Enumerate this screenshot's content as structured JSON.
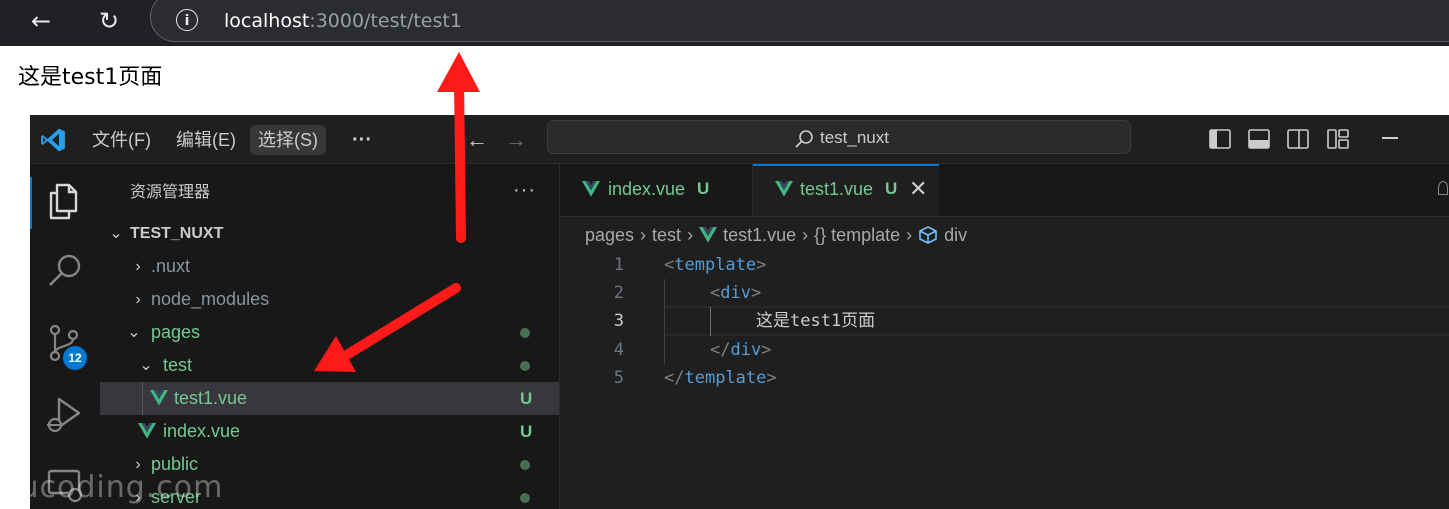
{
  "browser": {
    "url_host": "localhost",
    "url_path": ":3000/test/test1"
  },
  "page": {
    "heading": "这是test1页面"
  },
  "vscode": {
    "menu": {
      "file": "文件(F)",
      "edit": "编辑(E)",
      "select": "选择(S)",
      "more": "···"
    },
    "command_center": "test_nuxt",
    "badge_count": "12",
    "explorer": {
      "title": "资源管理器",
      "more": "···",
      "root": "TEST_NUXT",
      "items": [
        {
          "label": ".nuxt"
        },
        {
          "label": "node_modules"
        },
        {
          "label": "pages"
        },
        {
          "label": "test"
        },
        {
          "label": "test1.vue",
          "status": "U"
        },
        {
          "label": "index.vue",
          "status": "U"
        },
        {
          "label": "public"
        },
        {
          "label": "server"
        }
      ]
    },
    "tabs": [
      {
        "label": "index.vue",
        "status": "U"
      },
      {
        "label": "test1.vue",
        "status": "U"
      }
    ],
    "breadcrumb": {
      "pages": "pages",
      "test": "test",
      "file": "test1.vue",
      "template": "{} template",
      "div": "div"
    },
    "code": {
      "line_numbers": [
        "1",
        "2",
        "3",
        "4",
        "5"
      ],
      "line3_text": "这是test1页面",
      "tag_template": "template",
      "tag_div": "div"
    }
  },
  "colors": {
    "vue_green": "#41b883",
    "git_untracked": "#73c991",
    "accent": "#0078d4",
    "arrow": "#ff1a1a"
  },
  "watermark": "kucoding.com"
}
